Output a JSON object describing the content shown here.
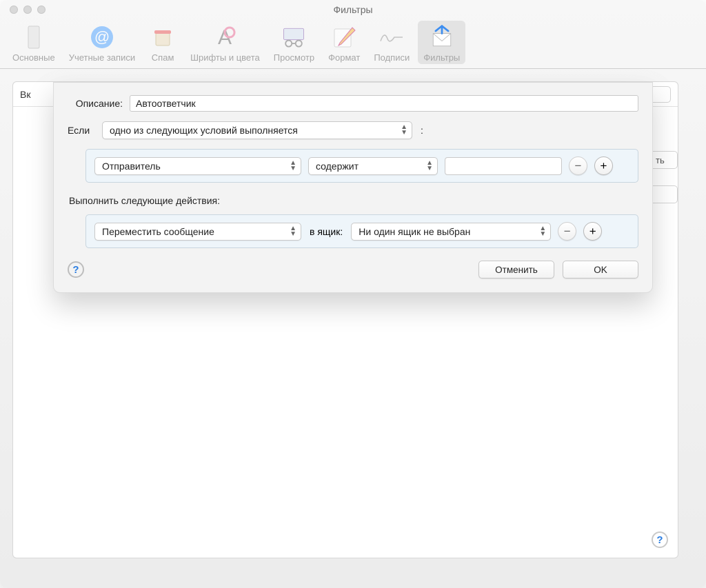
{
  "window": {
    "title": "Фильтры"
  },
  "toolbar": {
    "items": [
      {
        "label": "Основные"
      },
      {
        "label": "Учетные записи"
      },
      {
        "label": "Спам"
      },
      {
        "label": "Шрифты и цвета"
      },
      {
        "label": "Просмотр"
      },
      {
        "label": "Формат"
      },
      {
        "label": "Подписи"
      },
      {
        "label": "Фильтры"
      }
    ]
  },
  "panel": {
    "left_header": "Вк",
    "right_hint": "ть"
  },
  "sheet": {
    "description_label": "Описание:",
    "description_value": "Автоответчик",
    "if_label": "Если",
    "if_condition": "одно из следующих условий выполняется",
    "colon": ":",
    "condition": {
      "field": "Отправитель",
      "op": "содержит",
      "value": ""
    },
    "actions_label": "Выполнить следующие действия:",
    "action": {
      "type": "Переместить сообщение",
      "to_label": "в ящик:",
      "mailbox": "Ни один ящик не выбран"
    },
    "buttons": {
      "cancel": "Отменить",
      "ok": "OK"
    }
  }
}
